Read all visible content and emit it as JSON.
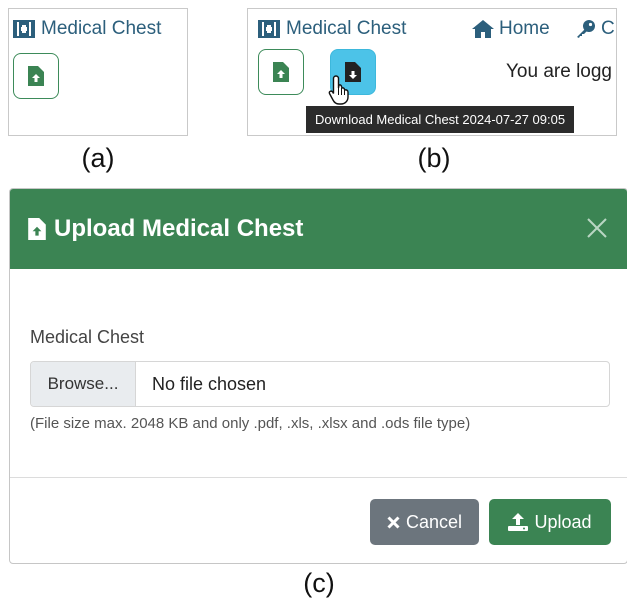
{
  "panel_a": {
    "brand": "Medical Chest",
    "caption": "(a)"
  },
  "panel_b": {
    "brand": "Medical Chest",
    "nav_home": "Home",
    "nav_partial": "C",
    "login_text": "You are logg",
    "tooltip": "Download Medical Chest 2024-07-27 09:05",
    "caption": "(b)"
  },
  "modal": {
    "title": "Upload Medical Chest",
    "field_label": "Medical Chest",
    "browse_label": "Browse...",
    "file_status": "No file chosen",
    "hint": "(File size max. 2048 KB and only .pdf, .xls, .xlsx and .ods file type)",
    "cancel_label": "Cancel",
    "upload_label": "Upload"
  },
  "caption_c": "(c)",
  "colors": {
    "brand_text": "#2c5f7c",
    "upload_green": "#3b8453",
    "download_blue": "#4cc3e8",
    "cancel_gray": "#6c757d"
  },
  "icons": {
    "brand": "medkit-icon",
    "upload": "file-upload-icon",
    "download": "file-download-icon",
    "home": "home-icon",
    "key": "key-icon",
    "cursor": "hand-pointer-icon",
    "close": "close-icon",
    "cancel": "x-icon",
    "upload_btn": "upload-icon"
  }
}
